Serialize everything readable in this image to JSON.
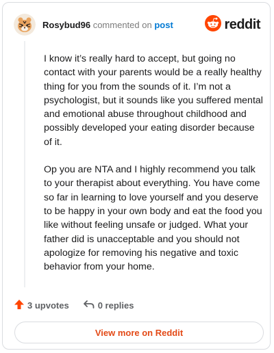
{
  "header": {
    "username": "Rosybud96",
    "commented_text": "commented on",
    "post_link": "post",
    "brand": "reddit",
    "avatar_icon": "tiger-avatar-icon",
    "brand_icon": "reddit-alien-icon"
  },
  "comment": {
    "paragraphs": [
      "I know it’s really hard to accept, but going no contact with your parents would be a really healthy thing for you from the sounds of it. I’m not a psychologist, but it sounds like you suffered mental and emotional abuse throughout childhood and possibly developed your eating disorder because of it.",
      "Op you are NTA and I highly recommend you talk to your therapist about everything. You have come so far in learning to love yourself and you deserve to be happy in your own body and eat the food you like without feeling unsafe or judged. What your father did is unacceptable and you should not apologize for removing his negative and toxic behavior from your home."
    ]
  },
  "actions": {
    "upvotes": "3 upvotes",
    "replies": "0 replies"
  },
  "footer": {
    "view_more": "View more on Reddit"
  },
  "colors": {
    "accent": "#ff4500",
    "link": "#0079d3",
    "view_more": "#e34a17"
  }
}
